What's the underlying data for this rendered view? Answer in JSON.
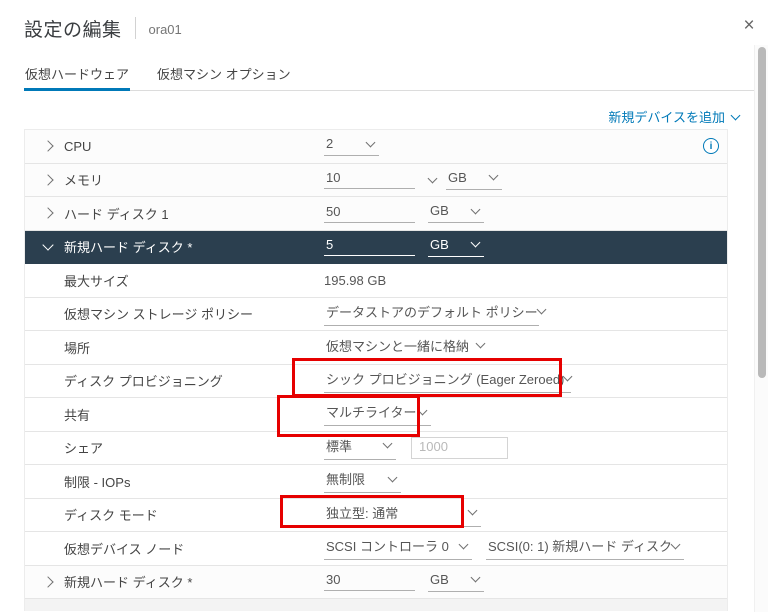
{
  "dialog": {
    "title": "設定の編集",
    "vm_name": "ora01"
  },
  "tabs": [
    {
      "label": "仮想ハードウェア",
      "active": true
    },
    {
      "label": "仮想マシン オプション",
      "active": false
    }
  ],
  "toolbar": {
    "add_device_label": "新規デバイスを追加"
  },
  "rows": [
    {
      "label": "CPU",
      "value": "2"
    },
    {
      "label": "メモリ",
      "value": "10",
      "unit": "GB"
    },
    {
      "label": "ハード ディスク 1",
      "value": "50",
      "unit": "GB"
    },
    {
      "label": "新規ハード ディスク *",
      "value": "5",
      "unit": "GB",
      "selected": true
    },
    {
      "label": "最大サイズ",
      "value": "195.98 GB"
    },
    {
      "label": "仮想マシン ストレージ ポリシー",
      "value": "データストアのデフォルト ポリシー"
    },
    {
      "label": "場所",
      "value": "仮想マシンと一緒に格納"
    },
    {
      "label": "ディスク プロビジョニング",
      "value": "シック プロビジョニング (Eager Zeroed)",
      "highlighted": true
    },
    {
      "label": "共有",
      "value": "マルチライター",
      "highlighted": true
    },
    {
      "label": "シェア",
      "value": "標準",
      "value2": "1000"
    },
    {
      "label": "制限 - IOPs",
      "value": "無制限"
    },
    {
      "label": "ディスク モード",
      "value": "独立型: 通常",
      "highlighted": true
    },
    {
      "label": "仮想デバイス ノード",
      "value": "SCSI コントローラ 0",
      "value2": "SCSI(0: 1) 新規ハード ディスク"
    },
    {
      "label": "新規ハード ディスク *",
      "value": "30",
      "unit": "GB"
    }
  ],
  "icons": {
    "close": "×",
    "info": "i"
  },
  "colors": {
    "accent_blue": "#0079b8",
    "selected_row": "#2b3f4f",
    "annotation_red": "#e60000"
  }
}
